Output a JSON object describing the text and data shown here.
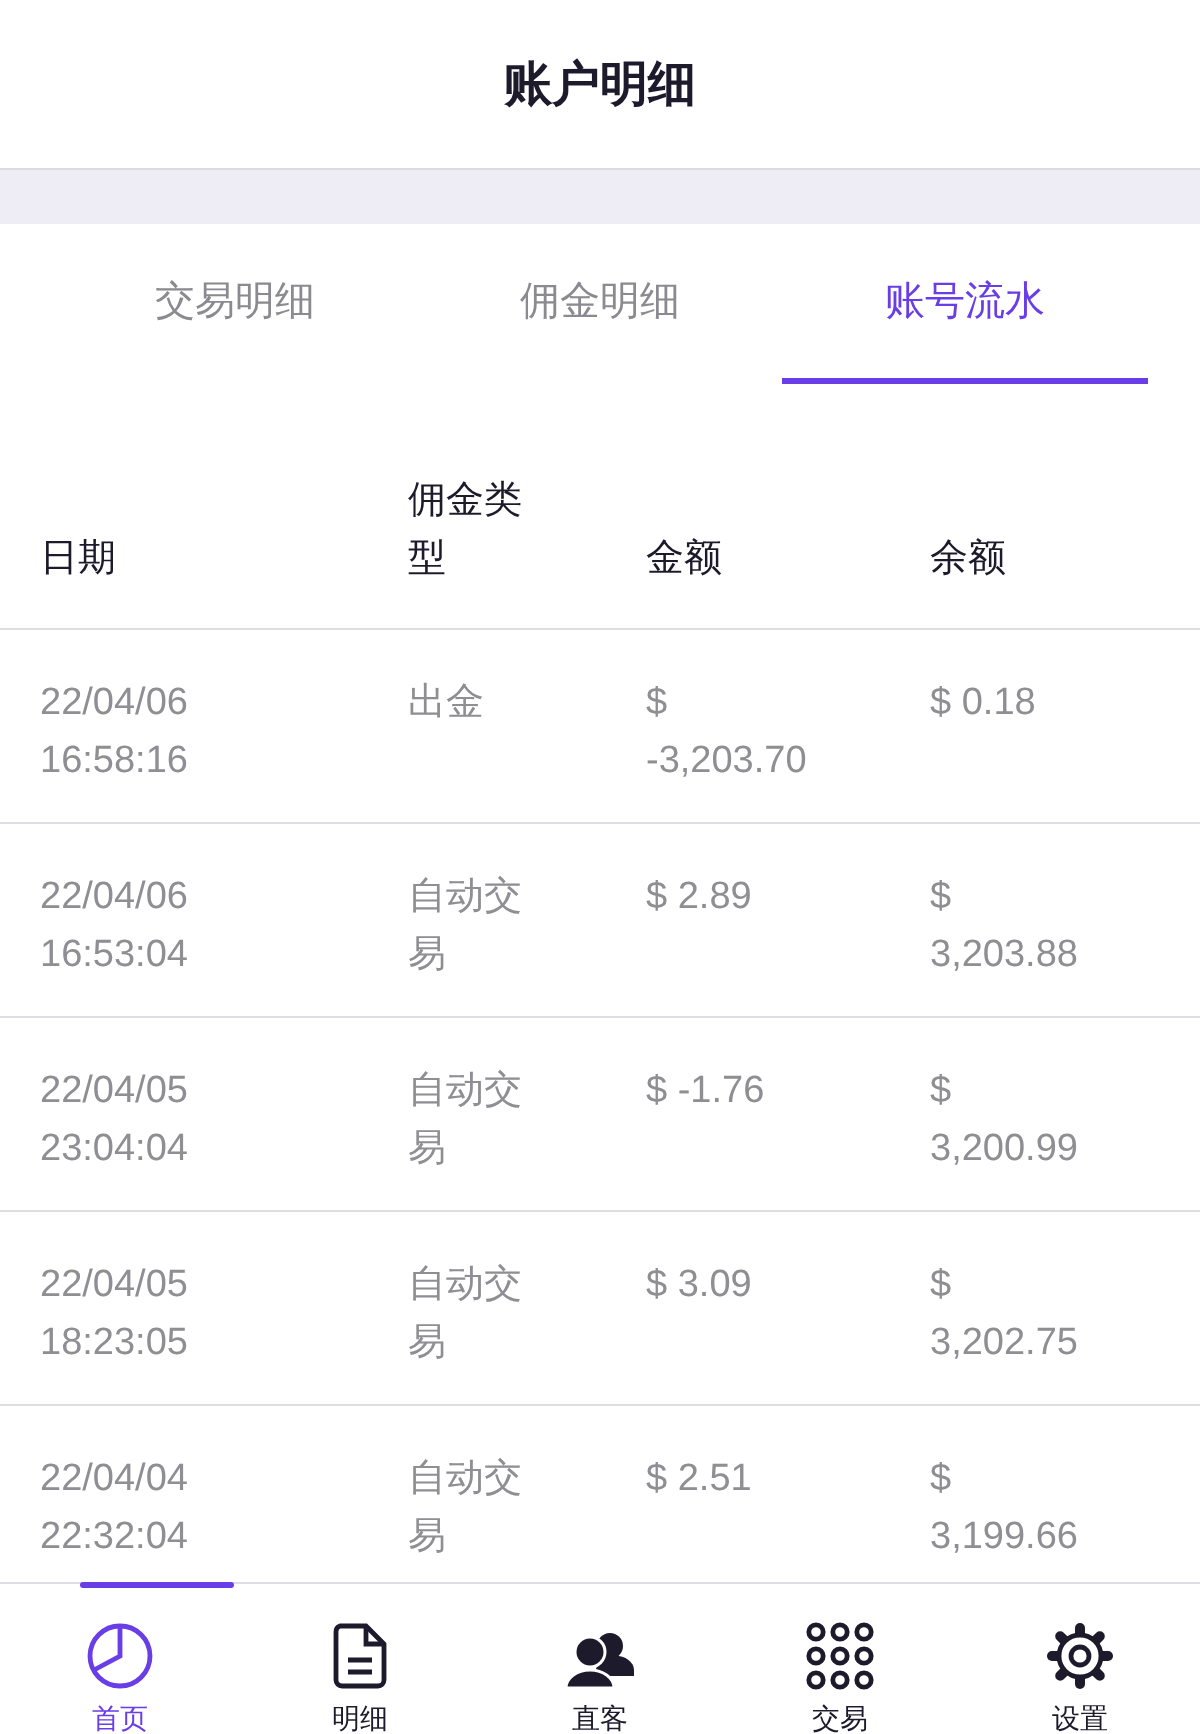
{
  "header": {
    "title": "账户明细"
  },
  "tabs": [
    {
      "label": "交易明细",
      "selected": false
    },
    {
      "label": "佣金明细",
      "selected": false
    },
    {
      "label": "账号流水",
      "selected": true
    }
  ],
  "table": {
    "columns": [
      "日期",
      "佣金类型",
      "金额",
      "余额"
    ],
    "rows": [
      {
        "date": "22/04/06 16:58:16",
        "type": "出金",
        "amount": "$ -3,203.70",
        "balance": "$ 0.18"
      },
      {
        "date": "22/04/06 16:53:04",
        "type": "自动交易",
        "amount": "$ 2.89",
        "balance": "$ 3,203.88"
      },
      {
        "date": "22/04/05 23:04:04",
        "type": "自动交易",
        "amount": "$ -1.76",
        "balance": "$ 3,200.99"
      },
      {
        "date": "22/04/05 18:23:05",
        "type": "自动交易",
        "amount": "$ 3.09",
        "balance": "$ 3,202.75"
      },
      {
        "date": "22/04/04 22:32:04",
        "type": "自动交易",
        "amount": "$ 2.51",
        "balance": "$ 3,199.66"
      }
    ]
  },
  "bottom_nav": [
    {
      "label": "首页",
      "selected": true
    },
    {
      "label": "明细",
      "selected": false
    },
    {
      "label": "直客",
      "selected": false
    },
    {
      "label": "交易",
      "selected": false
    },
    {
      "label": "设置",
      "selected": false
    }
  ]
}
